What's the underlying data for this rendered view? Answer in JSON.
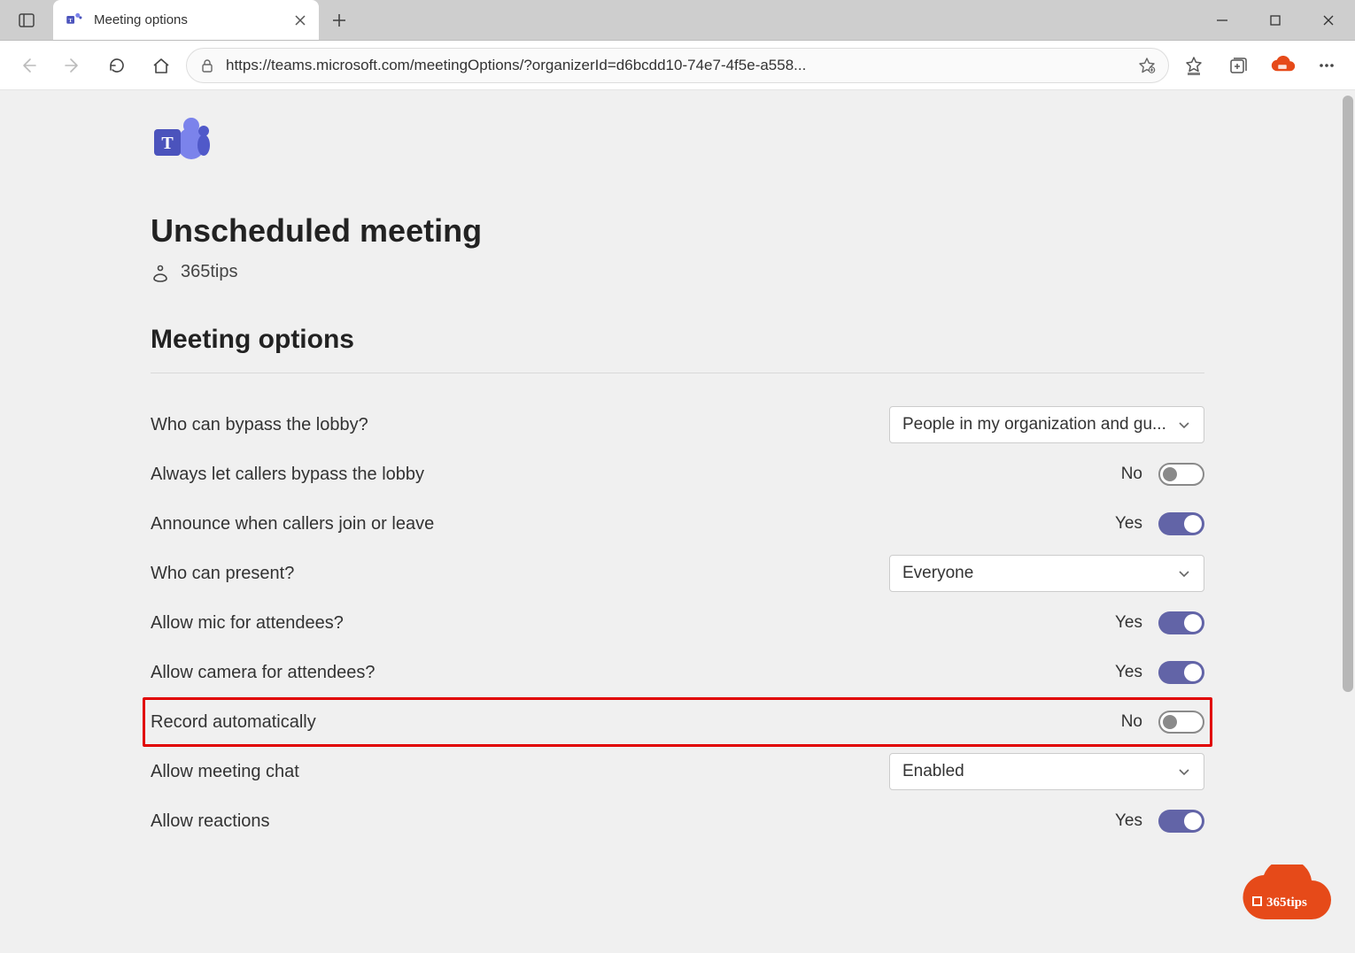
{
  "browser": {
    "tab_title": "Meeting options",
    "url_display": "https://teams.microsoft.com/meetingOptions/?organizerId=d6bcdd10-74e7-4f5e-a558..."
  },
  "page": {
    "title": "Unscheduled meeting",
    "presenter": "365tips",
    "section_title": "Meeting options"
  },
  "options": {
    "bypass_lobby": {
      "label": "Who can bypass the lobby?",
      "value": "People in my organization and gu..."
    },
    "callers_bypass": {
      "label": "Always let callers bypass the lobby",
      "state_label": "No",
      "on": false
    },
    "announce_callers": {
      "label": "Announce when callers join or leave",
      "state_label": "Yes",
      "on": true
    },
    "who_present": {
      "label": "Who can present?",
      "value": "Everyone"
    },
    "allow_mic": {
      "label": "Allow mic for attendees?",
      "state_label": "Yes",
      "on": true
    },
    "allow_camera": {
      "label": "Allow camera for attendees?",
      "state_label": "Yes",
      "on": true
    },
    "record_auto": {
      "label": "Record automatically",
      "state_label": "No",
      "on": false
    },
    "allow_chat": {
      "label": "Allow meeting chat",
      "value": "Enabled"
    },
    "allow_reactions": {
      "label": "Allow reactions",
      "state_label": "Yes",
      "on": true
    }
  },
  "watermark_text": "365tips"
}
